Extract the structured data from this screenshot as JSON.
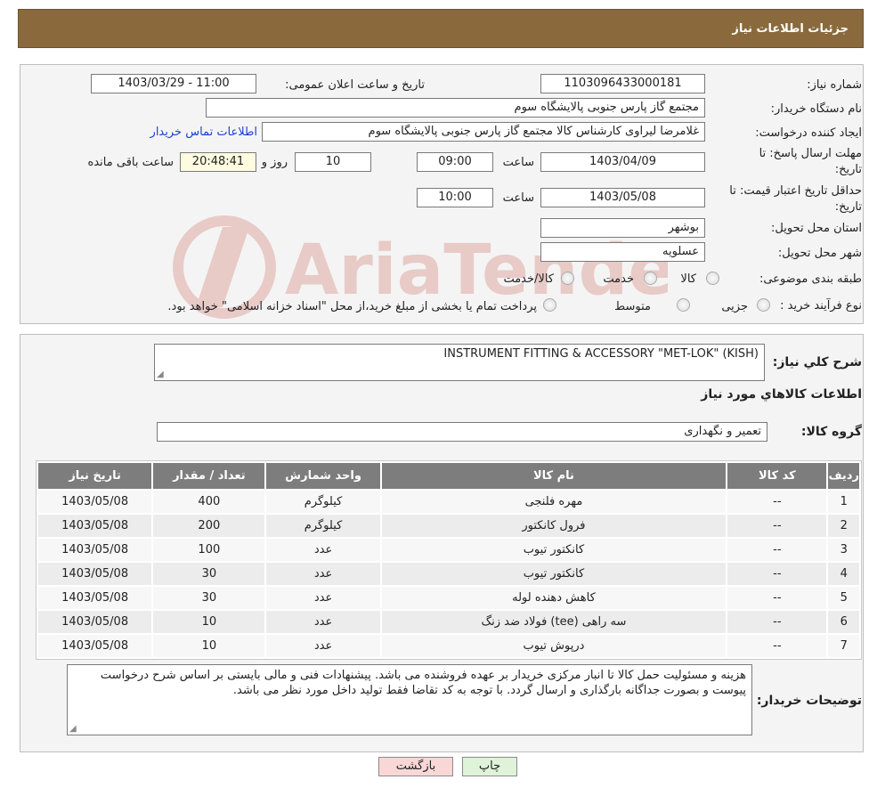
{
  "header": {
    "title": "جزئیات اطلاعات نیاز"
  },
  "form": {
    "need_number_label": "شماره نیاز:",
    "need_number": "1103096433000181",
    "announce_label": "تاریخ و ساعت اعلان عمومی:",
    "announce_value": "1403/03/29 - 11:00",
    "buyer_org_label": "نام دستگاه خریدار:",
    "buyer_org": "مجتمع گاز پارس جنوبی  پالایشگاه سوم",
    "creator_label": "ایجاد کننده درخواست:",
    "creator": "غلامرضا لیراوی کارشناس کالا مجتمع گاز پارس جنوبی  پالایشگاه سوم",
    "contact_link": "اطلاعات تماس خریدار",
    "deadline_label_1": "مهلت ارسال پاسخ: تا",
    "deadline_label_2": "تاریخ:",
    "deadline_date": "1403/04/09",
    "time_label": "ساعت",
    "deadline_time": "09:00",
    "days": "10",
    "days_label": "روز و",
    "remaining_time": "20:48:41",
    "remaining_label": "ساعت باقی مانده",
    "validity_label_1": "حداقل تاریخ اعتبار قیمت: تا",
    "validity_label_2": "تاریخ:",
    "validity_date": "1403/05/08",
    "validity_time": "10:00",
    "province_label": "استان محل تحویل:",
    "province": "بوشهر",
    "city_label": "شهر محل تحویل:",
    "city": "عسلویه",
    "category_label": "طبقه بندی موضوعی:",
    "category_options": [
      "کالا",
      "خدمت",
      "کالا/خدمت"
    ],
    "process_label": "نوع فرآیند خرید :",
    "process_options": [
      "جزیی",
      "متوسط"
    ],
    "payment_note": "پرداخت تمام یا بخشی از مبلغ خرید،از محل \"اسناد خزانه اسلامی\" خواهد بود."
  },
  "watermark": {
    "text": "AriaTender.neT"
  },
  "details": {
    "summary_label": "شرح کلي نياز:",
    "summary": "INSTRUMENT FITTING & ACCESSORY \"MET-LOK\" (KISH)",
    "goods_info_title": "اطلاعات کالاهاي مورد نياز",
    "goods_group_label": "گروه کالا:",
    "goods_group": "تعمیر و نگهداری"
  },
  "table": {
    "headers": [
      "ردیف",
      "کد کالا",
      "نام کالا",
      "واحد شمارش",
      "تعداد / مقدار",
      "تاریخ نیاز"
    ],
    "rows": [
      [
        "1",
        "--",
        "مهره فلنجی",
        "کیلوگرم",
        "400",
        "1403/05/08"
      ],
      [
        "2",
        "--",
        "فرول کانکتور",
        "کیلوگرم",
        "200",
        "1403/05/08"
      ],
      [
        "3",
        "--",
        "کانکتور تیوب",
        "عدد",
        "100",
        "1403/05/08"
      ],
      [
        "4",
        "--",
        "کانکتور تیوب",
        "عدد",
        "30",
        "1403/05/08"
      ],
      [
        "5",
        "--",
        "کاهش دهنده لوله",
        "عدد",
        "30",
        "1403/05/08"
      ],
      [
        "6",
        "--",
        "سه راهی (tee) فولاد ضد زنگ",
        "عدد",
        "10",
        "1403/05/08"
      ],
      [
        "7",
        "--",
        "درپوش تیوب",
        "عدد",
        "10",
        "1403/05/08"
      ]
    ]
  },
  "notes": {
    "label": "توضیحات خریدار:",
    "text": "هزینه و مسئولیت حمل کالا تا انبار مرکزی خریدار بر عهده فروشنده می باشد. پیشنهادات فنی و مالی بایستی بر اساس شرح درخواست پیوست و بصورت جداگانه بارگذاری و ارسال گردد. با توجه به کد تقاضا فقط تولید داخل مورد نظر می باشد."
  },
  "buttons": {
    "print": "چاپ",
    "back": "بازگشت"
  },
  "colors": {
    "header_bg": "#8a6a3d",
    "table_header_bg": "#7d7d7d",
    "back_btn_bg": "#f9d7d7",
    "print_btn_bg": "#dff3d9"
  }
}
